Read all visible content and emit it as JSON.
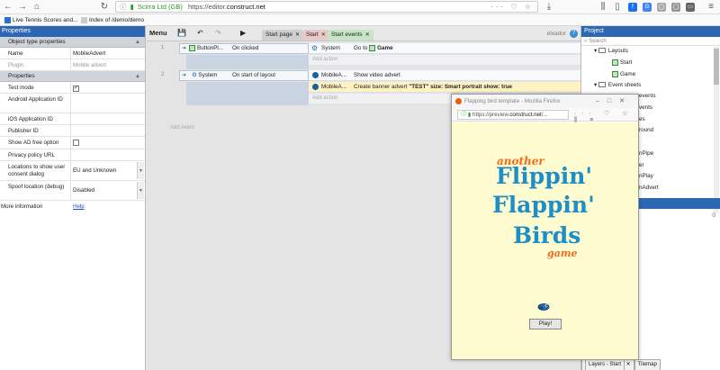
{
  "browser": {
    "url_info": "ⓘ",
    "site_identity": "Scirra Ltd (GB)",
    "url_prefix": "https://editor.",
    "url_domain": "construct.net",
    "bookmarks": [
      {
        "label": "Live Tennis Scores and..."
      },
      {
        "label": "Index of /demo/demo"
      }
    ]
  },
  "properties_panel": {
    "title": "Properties",
    "section_object": "Object type properties",
    "name_label": "Name",
    "name_value": "MobileAdvert",
    "plugin_label": "Plugin",
    "plugin_value": "Mobile advert",
    "section_props": "Properties",
    "rows": [
      {
        "label": "Test mode",
        "value": "",
        "checkbox": true,
        "checked": true
      },
      {
        "label": "Android Application ID",
        "value": ""
      },
      {
        "label": "iOS Application ID",
        "value": ""
      },
      {
        "label": "Publisher ID",
        "value": ""
      },
      {
        "label": "Show AD free option",
        "value": "",
        "checkbox": true,
        "checked": false
      },
      {
        "label": "Privacy policy URL",
        "value": ""
      },
      {
        "label": "Locations to show user consent dialog",
        "value": "EU and Unknown"
      },
      {
        "label": "Spoof location (debug)",
        "value": "Disabled"
      }
    ],
    "more_info_label": "More information",
    "more_info_link": "Help"
  },
  "editor": {
    "menu_label": "Menu",
    "tabs": [
      {
        "label": "Start page"
      },
      {
        "label": "Start"
      },
      {
        "label": "Start events"
      }
    ],
    "username": "elxador",
    "events": [
      {
        "number": "1",
        "condition_object": "ButtonPl...",
        "condition": "On clicked",
        "actions": [
          {
            "object": "System",
            "text_pre": "Go to",
            "text_bold": "Game"
          }
        ],
        "add_action": "Add action"
      },
      {
        "number": "2",
        "condition_object": "System",
        "condition": "On start of layout",
        "actions": [
          {
            "object": "MobileA...",
            "text_pre": "Show video advert",
            "text_bold": ""
          },
          {
            "object": "MobileA...",
            "text_pre": "Create banner advert",
            "text_bold": "\"TEST\" size: Smart portrait show: true"
          }
        ],
        "add_action": "Add action"
      }
    ],
    "add_event": "Add event"
  },
  "popup": {
    "title": "Flapping bird template - Mozilla Firefox",
    "url_prefix": "https://preview.",
    "url_domain": "construct.net",
    "url_suffix": "/...",
    "game_title_1": "another",
    "game_title_2": "Flippin'",
    "game_title_3": "Flappin'",
    "game_title_4": "Birds",
    "game_title_5": "game",
    "play_label": "Play!"
  },
  "project_panel": {
    "title": "Project",
    "search_placeholder": "Search",
    "items": [
      {
        "label": "Layouts"
      },
      {
        "label": "Start"
      },
      {
        "label": "Game"
      },
      {
        "label": "Event sheets"
      },
      {
        "label": "events"
      },
      {
        "label": "vents"
      },
      {
        "label": "es"
      },
      {
        "label": "round"
      },
      {
        "label": "nPipe"
      },
      {
        "label": "er"
      },
      {
        "label": "nPlay"
      },
      {
        "label": "nAdvert"
      }
    ],
    "layers_count": "0",
    "bottom_tab_1": "Layers - Start",
    "bottom_tab_2": "Tilemap"
  },
  "colors": {
    "accent": "#2d67b3",
    "game_orange": "#f26a1b",
    "game_blue": "#1e8fc6",
    "game_bg": "#fffbd0"
  }
}
